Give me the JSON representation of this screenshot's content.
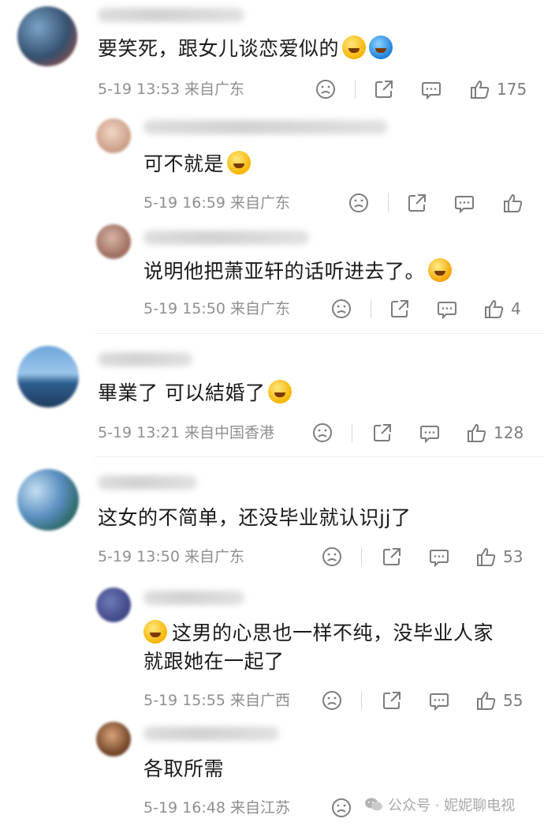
{
  "comments": [
    {
      "text": "要笑死，跟女儿谈恋爱似的",
      "emojis": [
        "laugh-cry",
        "blue"
      ],
      "date": "5-19 13:53",
      "location": "来自广东",
      "likes": "175",
      "level": 0
    },
    {
      "text": "可不就是",
      "emojis": [
        "laugh-cry"
      ],
      "date": "5-19 16:59",
      "location": "来自广东",
      "likes": "",
      "level": 1
    },
    {
      "text": "说明他把萧亚轩的话听进去了。",
      "emojis": [
        "big-laugh"
      ],
      "date": "5-19 15:50",
      "location": "来自广东",
      "likes": "4",
      "level": 1
    },
    {
      "text": "畢業了 可以結婚了",
      "emojis": [
        "tear-smile"
      ],
      "date": "5-19 13:21",
      "location": "来自中国香港",
      "likes": "128",
      "level": 0
    },
    {
      "text": "这女的不简单，还没毕业就认识jj了",
      "emojis": [],
      "date": "5-19 13:50",
      "location": "来自广东",
      "likes": "53",
      "level": 0
    },
    {
      "text_line1": "这男的心思也一样不纯，没毕业人家",
      "text_line2": "就跟她在一起了",
      "emojis": [
        "shush"
      ],
      "date": "5-19 15:55",
      "location": "来自广西",
      "likes": "55",
      "level": 1
    },
    {
      "text": "各取所需",
      "emojis": [],
      "date": "5-19 16:48",
      "location": "来自江苏",
      "likes": "",
      "level": 1
    }
  ],
  "watermark": {
    "label": "公众号 · 妮妮聊电视",
    "icon": "wechat-icon"
  },
  "colors": {
    "text": "#1a1a1a",
    "meta": "#8f8f8f",
    "icon": "#7d7d7d"
  },
  "icons": [
    "dislike-icon",
    "share-icon",
    "comment-icon",
    "like-icon"
  ]
}
